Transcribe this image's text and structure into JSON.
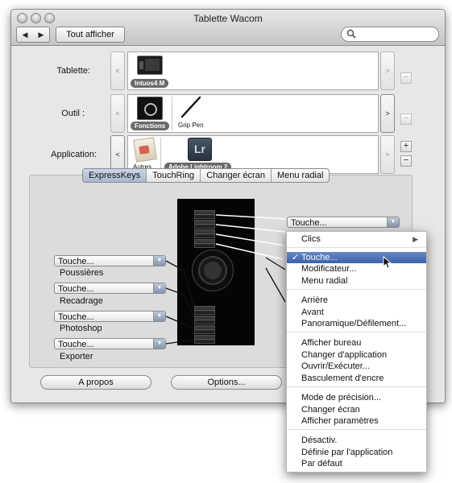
{
  "window": {
    "title": "Tablette Wacom"
  },
  "toolbar": {
    "back": "◀",
    "forward": "▶",
    "show_all": "Tout afficher",
    "search_placeholder": ""
  },
  "rows": {
    "tablette": {
      "label": "Tablette:",
      "item": "Intuos4 M"
    },
    "outil": {
      "label": "Outil :",
      "items": [
        "Fonctions",
        "Grip Pen"
      ]
    },
    "application": {
      "label": "Application:",
      "items": [
        "Autres",
        "Adobe Lightroom 2"
      ]
    }
  },
  "nav": {
    "left": "<",
    "right": ">",
    "minus": "−",
    "plus": "+"
  },
  "tabs": [
    "ExpressKeys",
    "TouchRing",
    "Changer écran",
    "Menu radial"
  ],
  "left_keys": [
    {
      "value": "Touche...",
      "label": "Poussières"
    },
    {
      "value": "Touche...",
      "label": "Recadrage"
    },
    {
      "value": "Touche...",
      "label": "Photoshop"
    },
    {
      "value": "Touche...",
      "label": "Exporter"
    }
  ],
  "top_popup": "Touche...",
  "buttons": {
    "about": "A propos",
    "options": "Options..."
  },
  "menu": {
    "groups": [
      [
        "Clics"
      ],
      [
        "Touche...",
        "Modificateur...",
        "Menu radial"
      ],
      [
        "Arrière",
        "Avant",
        "Panoramique/Défilement..."
      ],
      [
        "Afficher bureau",
        "Changer d'application",
        "Ouvrir/Exécuter...",
        "Basculement d'encre"
      ],
      [
        "Mode de précision...",
        "Changer écran",
        "Afficher paramètres"
      ],
      [
        "Désactiv.",
        "Définie par l'application",
        "Par défaut"
      ]
    ],
    "checked": "Touche...",
    "submenu_arrow": "▶"
  }
}
